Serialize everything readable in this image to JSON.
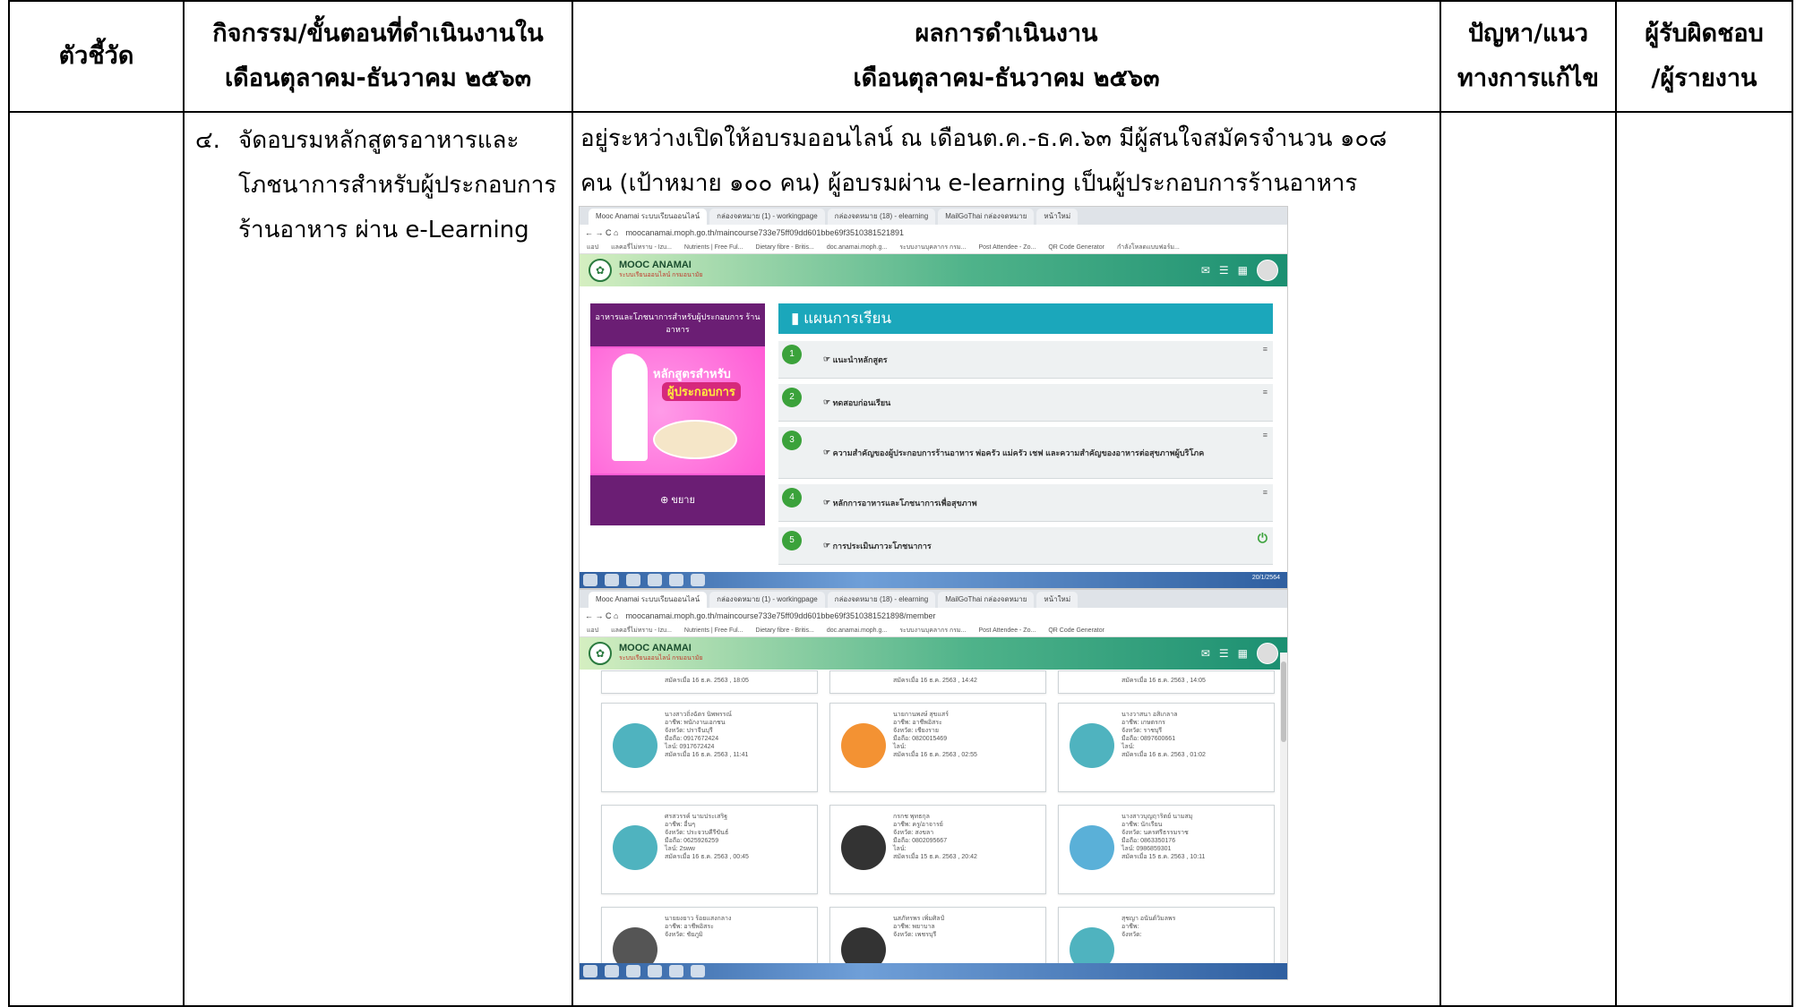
{
  "headers": {
    "col1": "ตัวชี้วัด",
    "col2_line1": "กิจกรรม/ขั้นตอนที่ดำเนินงานใน",
    "col2_line2": "เดือนตุลาคม-ธันวาคม ๒๕๖๓",
    "col3_line1": "ผลการดำเนินงาน",
    "col3_line2": "เดือนตุลาคม-ธันวาคม ๒๕๖๓",
    "col4_line1": "ปัญหา/แนว",
    "col4_line2": "ทางการแก้ไข",
    "col5_line1": "ผู้รับผิดชอบ",
    "col5_line2": "/ผู้รายงาน"
  },
  "activity": {
    "number": "๔.",
    "line1": "จัดอบรมหลักสูตรอาหารและ",
    "line2": "โภชนาการสำหรับผู้ประกอบการ",
    "line3": "ร้านอาหาร ผ่าน e-Learning"
  },
  "result": {
    "line1": "อยู่ระหว่างเปิดให้อบรมออนไลน์ ณ เดือนต.ค.-ธ.ค.๖๓ มีผู้สนใจสมัครจำนวน ๑๐๘",
    "line2": "คน (เป้าหมาย ๑๐๐ คน) ผู้อบรมผ่าน e-learning เป็นผู้ประกอบการร้านอาหาร"
  },
  "screenshot1": {
    "tabs": [
      "Mooc Anamai ระบบเรียนออนไลน์",
      "กล่องจดหมาย (1) - workingpage",
      "กล่องจดหมาย (18) - elearning",
      "MailGoThai กล่องจดหมาย",
      "หน้าใหม่"
    ],
    "url": "moocanamai.moph.go.th/maincourse733e75ff09dd601bbe69f3510381521891",
    "bookmarks": [
      "แอป",
      "แลคอรี่ไม่ทราบ - Izu...",
      "Nutrients | Free Ful...",
      "Dietary fibre - Britis...",
      "doc.anamai.moph.g...",
      "ระบบงานบุคลากร กรม...",
      "Post Attendee - Zo...",
      "QR Code Generator",
      "กำลังโหลดแบบฟอร์ม..."
    ],
    "brand": "MOOC ANAMAI",
    "brand_sub": "ระบบเรียนออนไลน์ กรมอนามัย",
    "course_title": "อาหารและโภชนาการสำหรับผู้ประกอบการ ร้านอาหาร",
    "art_line1": "หลักสูตรสำหรับ",
    "art_line2": "ผู้ประกอบการ",
    "zoom_label": "ขยาย",
    "plan_title": "แผนการเรียน",
    "lessons": [
      {
        "n": "1",
        "text": "แนะนำหลักสูตร"
      },
      {
        "n": "2",
        "text": "ทดสอบก่อนเรียน"
      },
      {
        "n": "3",
        "text": "ความสำคัญของผู้ประกอบการร้านอาหาร พ่อครัว แม่ครัว เชฟ และความสำคัญของอาหารต่อสุขภาพผู้บริโภค"
      },
      {
        "n": "4",
        "text": "หลักการอาหารและโภชนาการเพื่อสุขภาพ"
      },
      {
        "n": "5",
        "text": "การประเมินภาวะโภชนาการ"
      }
    ],
    "clock": "20/1/2564"
  },
  "screenshot2": {
    "url": "moocanamai.moph.go.th/maincourse733e75ff09dd601bbe69f3510381521898/member",
    "brand": "MOOC ANAMAI",
    "brand_sub": "ระบบเรียนออนไลน์ กรมอนามัย",
    "members": [
      {
        "info": "นางสาวถิ่งฉัตร นิพพรรณ์\nอาชีพ: พนักงานเอกชน\nจังหวัด: ปราจีนบุรี\nมือถือ: 0917672424\nไลน์: 0917672424\nสมัครเมื่อ 16 ธ.ค. 2563 , 11:41"
      },
      {
        "info": "นายกานพงษ์ สุขแสร์\nอาชีพ: อาชีพอิสระ\nจังหวัด: เชียงราย\nมือถือ: 0820015469\nไลน์:\nสมัครเมื่อ 16 ธ.ค. 2563 , 02:55"
      },
      {
        "info": "นางวาสนา อสิเกลาล\nอาชีพ: เกษตรกร\nจังหวัด: ราชบุรี\nมือถือ: 0897600661\nไลน์:\nสมัครเมื่อ 16 ธ.ค. 2563 , 01:02"
      },
      {
        "info": "ศรสวรรค์ นามประเสริฐ\nอาชีพ: อื่นๆ\nจังหวัด: ประจวบคีรีขันธ์\nมือถือ: 0625926259\nไลน์: 2sww\nสมัครเมื่อ 16 ธ.ค. 2563 , 00:45"
      },
      {
        "info": "กรกช พุทธกุล\nอาชีพ: ครู/อาจารย์\nจังหวัด: สงขลา\nมือถือ: 0802095667\nไลน์:\nสมัครเมื่อ 15 ธ.ค. 2563 , 20:42"
      },
      {
        "info": "นางสาวบุญฤาริตย์ นามสมุ\nอาชีพ: นักเรียน\nจังหวัด: นครศรีธรรมราช\nมือถือ: 0863350176\nไลน์: 0986859301\nสมัครเมื่อ 15 ธ.ค. 2563 , 10:11"
      },
      {
        "info": "นายยงยาว ร้อยแสงกลาง\nอาชีพ: อาชีพอิสระ\nจังหวัด: ชัยภูมิ"
      },
      {
        "info": "นสภัทรพร เพิ่มศิลป์\nอาชีพ: พยาบาล\nจังหวัด: เพชรบุรี"
      },
      {
        "info": "สุชญา อนันต์วิมลพร\nอาชีพ:\nจังหวัด:"
      }
    ],
    "top_row_dates": [
      "สมัครเมื่อ 16 ธ.ค. 2563 , 18:05",
      "สมัครเมื่อ 16 ธ.ค. 2563 , 14:42",
      "สมัครเมื่อ 16 ธ.ค. 2563 , 14:05"
    ]
  }
}
